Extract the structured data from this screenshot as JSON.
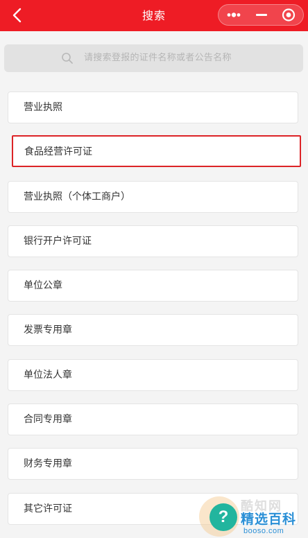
{
  "header": {
    "title": "搜索",
    "back_icon": "chevron-left-icon",
    "capsule_icons": [
      "more-dots-icon",
      "minimize-icon",
      "close-target-icon"
    ],
    "background_color": "#ee1c25"
  },
  "search": {
    "placeholder": "请搜索登报的证件名称或者公告名称",
    "icon": "search-icon"
  },
  "list": {
    "items": [
      {
        "label": "营业执照"
      },
      {
        "label": "食品经营许可证",
        "highlighted": true
      },
      {
        "label": "营业执照（个体工商户）"
      },
      {
        "label": "银行开户许可证"
      },
      {
        "label": "单位公章"
      },
      {
        "label": "发票专用章"
      },
      {
        "label": "单位法人章"
      },
      {
        "label": "合同专用章"
      },
      {
        "label": "财务专用章"
      },
      {
        "label": "其它许可证"
      }
    ],
    "highlight_color": "#dc2326"
  },
  "watermark": {
    "symbol": "?",
    "faint_text": "酷知网",
    "title": "精选百科",
    "domain": "booso.com"
  }
}
